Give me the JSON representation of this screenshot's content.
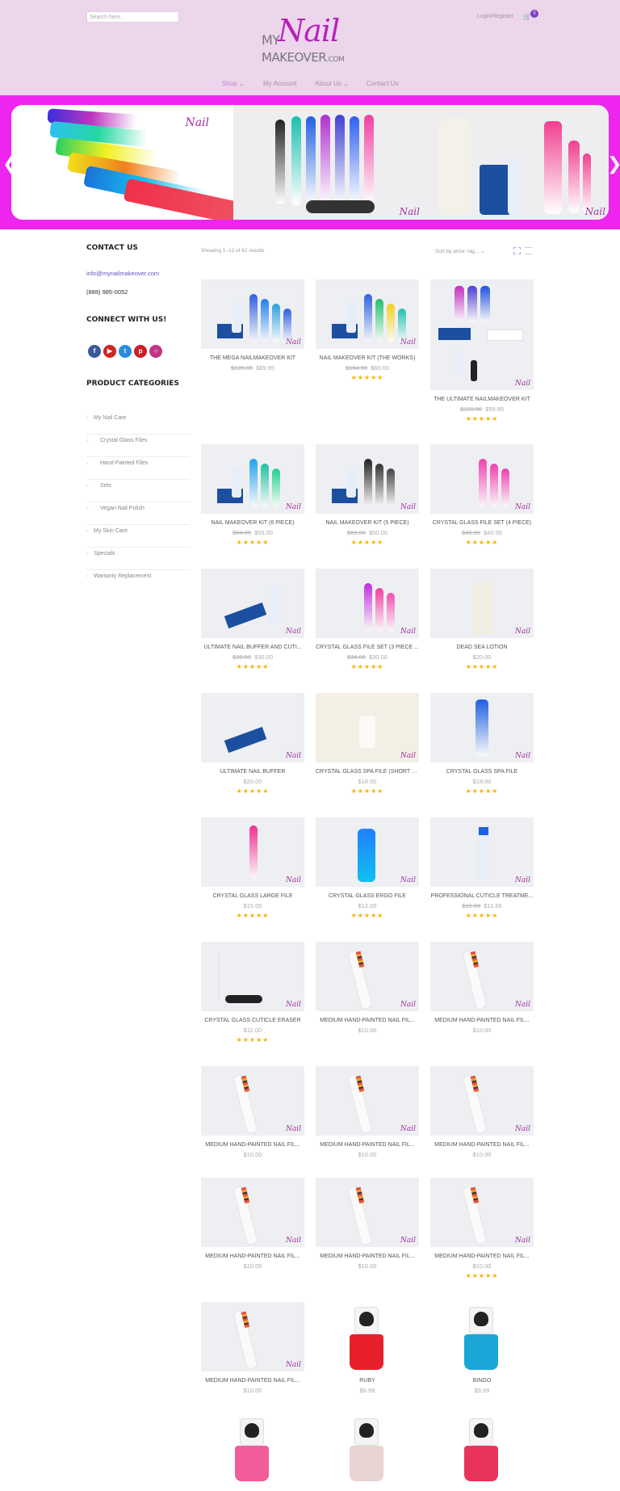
{
  "header": {
    "search_placeholder": "Search here...",
    "login": "Login/Register",
    "cart_count": "0",
    "logo": {
      "my": "MY",
      "nail": "Nail",
      "makeover": "MAKEOVER",
      "dotcom": ".COM"
    },
    "nav": [
      "Shop",
      "My Account",
      "About Us",
      "Contact Us"
    ]
  },
  "sidebar": {
    "contact_heading": "CONTACT US",
    "email": "info@mynailmakeover.com",
    "phone": "(888) 985-0052",
    "connect_heading": "CONNECT WITH US!",
    "categories_heading": "PRODUCT CATEGORIES",
    "categories": [
      "My Nail Care",
      "Crystal Glass Files",
      "Hand Painted Files",
      "Sets",
      "Vegan Nail Polish",
      "My Skin Care",
      "Specials",
      "Warranty Replacement"
    ]
  },
  "shop": {
    "results": "Showing 1–12 of 62 results",
    "sort": "Sort by price: hig...",
    "products": [
      {
        "name": "THE MEGA NAILMAKEOVER KIT",
        "old": "$135.00",
        "price": "$69.95",
        "stars": ""
      },
      {
        "name": "NAIL MAKEOVER KIT (THE WORKS)",
        "old": "$104.00",
        "price": "$60.00",
        "stars": "★★★★★"
      },
      {
        "name": "THE ULTIMATE NAILMAKEOVER KIT",
        "old": "$120.00",
        "price": "$59.95",
        "stars": "★★★★★"
      },
      {
        "name": "NAIL MAKEOVER KIT (6 PIECE)",
        "old": "$84.00",
        "price": "$55.00",
        "stars": "★★★★★"
      },
      {
        "name": "NAIL MAKEOVER KIT (5 PIECE)",
        "old": "$69.00",
        "price": "$50.00",
        "stars": "★★★★★"
      },
      {
        "name": "CRYSTAL GLASS FILE SET (4 PIECE)",
        "old": "$49.00",
        "price": "$40.00",
        "stars": "★★★★★"
      },
      {
        "name": "ULTIMATE NAIL BUFFER AND CUTI...",
        "old": "$39.00",
        "price": "$30.00",
        "stars": "★★★★★"
      },
      {
        "name": "CRYSTAL GLASS FILE SET (3 PIECE ...",
        "old": "$34.00",
        "price": "$30.00",
        "stars": "★★★★★"
      },
      {
        "name": "DEAD SEA LOTION",
        "old": "",
        "price": "$20.00",
        "stars": "★★★★★"
      },
      {
        "name": "ULTIMATE NAIL BUFFER",
        "old": "",
        "price": "$20.00",
        "stars": "★★★★★"
      },
      {
        "name": "CRYSTAL GLASS SPA FILE (SHORT S...",
        "old": "",
        "price": "$18.00",
        "stars": "★★★★★"
      },
      {
        "name": "CRYSTAL GLASS SPA FILE",
        "old": "",
        "price": "$18.00",
        "stars": "★★★★★"
      },
      {
        "name": "CRYSTAL GLASS LARGE FILE",
        "old": "",
        "price": "$15.00",
        "stars": "★★★★★"
      },
      {
        "name": "CRYSTAL GLASS ERGO FILE",
        "old": "",
        "price": "$12.00",
        "stars": "★★★★★"
      },
      {
        "name": "PROFESSIONAL CUTICLE TREATME...",
        "old": "$15.00",
        "price": "$11.95",
        "stars": "★★★★★"
      },
      {
        "name": "CRYSTAL GLASS CUTICLE ERASER",
        "old": "",
        "price": "$11.00",
        "stars": "★★★★★"
      },
      {
        "name": "MEDIUM HAND-PAINTED NAIL FIL...",
        "old": "",
        "price": "$10.00",
        "stars": ""
      },
      {
        "name": "MEDIUM HAND-PAINTED NAIL FIL...",
        "old": "",
        "price": "$10.00",
        "stars": ""
      },
      {
        "name": "MEDIUM HAND-PAINTED NAIL FIL...",
        "old": "",
        "price": "$10.00",
        "stars": ""
      },
      {
        "name": "MEDIUM HAND-PAINTED NAIL FIL...",
        "old": "",
        "price": "$10.00",
        "stars": ""
      },
      {
        "name": "MEDIUM HAND-PAINTED NAIL FIL...",
        "old": "",
        "price": "$10.00",
        "stars": ""
      },
      {
        "name": "MEDIUM HAND-PAINTED NAIL FIL...",
        "old": "",
        "price": "$10.00",
        "stars": ""
      },
      {
        "name": "MEDIUM HAND-PAINTED NAIL FIL...",
        "old": "",
        "price": "$10.00",
        "stars": ""
      },
      {
        "name": "MEDIUM HAND-PAINTED NAIL FIL...",
        "old": "",
        "price": "$10.00",
        "stars": "★★★★★"
      },
      {
        "name": "MEDIUM HAND-PAINTED NAIL FIL...",
        "old": "",
        "price": "$10.00",
        "stars": ""
      },
      {
        "name": "RUBY",
        "old": "",
        "price": "$9.99",
        "stars": ""
      },
      {
        "name": "BINGO",
        "old": "",
        "price": "$9.99",
        "stars": ""
      },
      {
        "name": "",
        "old": "",
        "price": "",
        "stars": ""
      },
      {
        "name": "",
        "old": "",
        "price": "",
        "stars": ""
      },
      {
        "name": "",
        "old": "",
        "price": "",
        "stars": ""
      }
    ]
  },
  "colors": {
    "accent": "#ee25ee",
    "header_bg": "#ecd6ec",
    "star": "#f5b400",
    "link": "#6a4ec5"
  }
}
